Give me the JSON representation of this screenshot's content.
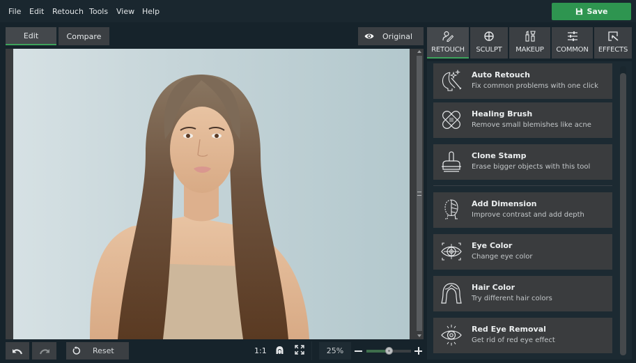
{
  "menu": {
    "items": [
      "File",
      "Edit",
      "Retouch",
      "Tools",
      "View",
      "Help"
    ],
    "save_label": "Save"
  },
  "view_tabs": [
    {
      "label": "Edit",
      "active": true
    },
    {
      "label": "Compare",
      "active": false
    }
  ],
  "original_label": "Original",
  "tool_tabs": [
    {
      "label": "RETOUCH",
      "icon": "retouch-icon",
      "active": true
    },
    {
      "label": "SCULPT",
      "icon": "sculpt-icon",
      "active": false
    },
    {
      "label": "MAKEUP",
      "icon": "makeup-icon",
      "active": false
    },
    {
      "label": "COMMON",
      "icon": "sliders-icon",
      "active": false
    },
    {
      "label": "EFFECTS",
      "icon": "effects-icon",
      "active": false
    }
  ],
  "tools": [
    {
      "title": "Auto Retouch",
      "desc": "Fix common problems with one click",
      "icon": "magic-face-icon"
    },
    {
      "title": "Healing Brush",
      "desc": "Remove small blemishes like acne",
      "icon": "bandage-icon"
    },
    {
      "title": "Clone Stamp",
      "desc": "Erase bigger objects with this tool",
      "icon": "stamp-icon"
    },
    {
      "title": "Add Dimension",
      "desc": "Improve contrast and add depth",
      "icon": "face-dimension-icon"
    },
    {
      "title": "Eye Color",
      "desc": "Change eye color",
      "icon": "eye-target-icon"
    },
    {
      "title": "Hair Color",
      "desc": "Try different hair colors",
      "icon": "hair-icon"
    },
    {
      "title": "Red Eye Removal",
      "desc": "Get rid of red eye effect",
      "icon": "red-eye-icon"
    }
  ],
  "bottom": {
    "reset_label": "Reset",
    "ratio_label": "1:1",
    "zoom_value": "25%",
    "zoom_slider_fraction": 0.5
  },
  "colors": {
    "accent_green": "#3ea35c",
    "save_green": "#2e9550"
  }
}
